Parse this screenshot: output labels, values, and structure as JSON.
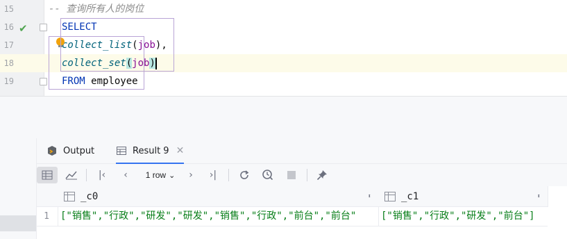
{
  "editor": {
    "lines": [
      {
        "num": "15",
        "text": "-- 查询所有人的岗位"
      },
      {
        "num": "16",
        "kw": "SELECT"
      },
      {
        "num": "17",
        "fn": "collect_list",
        "open": "(",
        "arg": "job",
        "close": ")",
        "tail": ","
      },
      {
        "num": "18",
        "fn": "collect_set",
        "open": "(",
        "arg": "job",
        "close": ")"
      },
      {
        "num": "19",
        "kw": "FROM",
        "tail": " employee"
      }
    ]
  },
  "tabs": {
    "output": "Output",
    "result": "Result 9"
  },
  "toolbar": {
    "rows": "1 row"
  },
  "grid": {
    "columns": [
      "_c0",
      "_c1"
    ],
    "rows": [
      {
        "num": "1",
        "c0": "[\"销售\",\"行政\",\"研发\",\"研发\",\"销售\",\"行政\",\"前台\",\"前台\"",
        "c1": "[\"销售\",\"行政\",\"研发\",\"前台\"]"
      }
    ]
  },
  "colors": {
    "keyword": "#0033b3",
    "function": "#00627a",
    "string": "#067d17",
    "accent": "#3574f0",
    "run_ok": "#4fa44f"
  }
}
